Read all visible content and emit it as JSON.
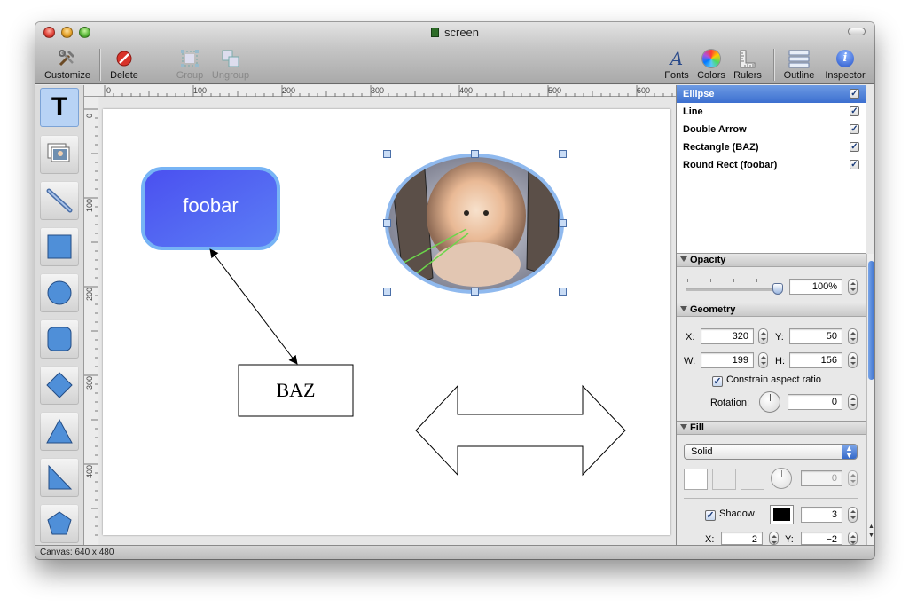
{
  "window": {
    "title": "screen"
  },
  "toolbar": {
    "customize": "Customize",
    "delete": "Delete",
    "group": "Group",
    "ungroup": "Ungroup",
    "fonts": "Fonts",
    "colors": "Colors",
    "rulers": "Rulers",
    "outline": "Outline",
    "inspector": "Inspector"
  },
  "tools": [
    "text-tool",
    "image-tool",
    "line-tool",
    "rectangle-tool",
    "oval-tool",
    "round-rect-tool",
    "diamond-tool",
    "triangle-tool",
    "right-triangle-tool",
    "pentagon-tool"
  ],
  "ruler": {
    "h_labels": [
      "0",
      "100",
      "200",
      "300",
      "400",
      "500",
      "600"
    ],
    "v_labels": [
      "0",
      "100",
      "200",
      "300",
      "400"
    ]
  },
  "canvas": {
    "round_rect_text": "foobar",
    "rect_text": "BAZ"
  },
  "layers": [
    {
      "name": "Ellipse",
      "checked": true,
      "selected": true
    },
    {
      "name": "Line",
      "checked": true,
      "selected": false
    },
    {
      "name": "Double Arrow",
      "checked": true,
      "selected": false
    },
    {
      "name": "Rectangle (BAZ)",
      "checked": true,
      "selected": false
    },
    {
      "name": "Round Rect (foobar)",
      "checked": true,
      "selected": false
    }
  ],
  "inspector": {
    "opacity": {
      "title": "Opacity",
      "value": "100%",
      "level": 1.0
    },
    "geometry": {
      "title": "Geometry",
      "x_label": "X:",
      "x": "320",
      "y_label": "Y:",
      "y": "50",
      "w_label": "W:",
      "w": "199",
      "h_label": "H:",
      "h": "156",
      "constrain": "Constrain aspect ratio",
      "rotation_label": "Rotation:",
      "rotation": "0"
    },
    "fill": {
      "title": "Fill",
      "type": "Solid",
      "angle": "0",
      "shadow_label": "Shadow",
      "shadow_color": "#000000",
      "shadow_size": "3",
      "x_label": "X:",
      "x": "2",
      "y_label": "Y:",
      "y": "−2"
    }
  },
  "status": "Canvas: 640 x 480",
  "colors": {
    "accent": "#3c6fd0",
    "foobar_fill": "#4f5cf0",
    "foobar_border": "#77b4f5",
    "selection_handle": "#c9dcf5"
  }
}
